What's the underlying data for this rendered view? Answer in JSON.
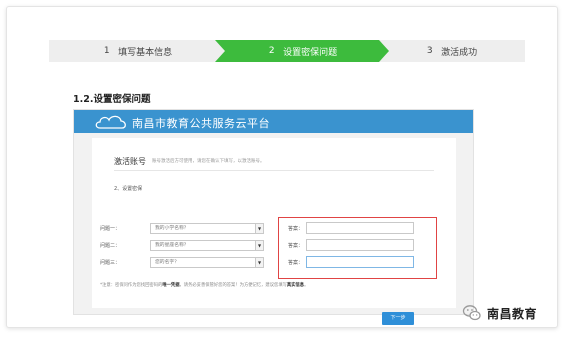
{
  "steps": [
    {
      "num": "1",
      "label": "填写基本信息",
      "state": "done"
    },
    {
      "num": "2",
      "label": "设置密保问题",
      "state": "active"
    },
    {
      "num": "3",
      "label": "激活成功",
      "state": "pending"
    }
  ],
  "section_title": "1.2.设置密保问题",
  "app": {
    "platform_name": "南昌市教育公共服务云平台",
    "panel_title": "激活账号",
    "panel_desc": "账号激活后方可使用，请您在确认下填写，以激活账号。",
    "subhead": "2、设置密保",
    "questions": [
      {
        "label": "问题一：",
        "selected": "我的小学名称？",
        "answer_label": "答案：",
        "answer": ""
      },
      {
        "label": "问题二：",
        "selected": "我的星座名称？",
        "answer_label": "答案：",
        "answer": ""
      },
      {
        "label": "问题三：",
        "selected": "您的名字？",
        "answer_label": "答案：",
        "answer": ""
      }
    ],
    "note_prefix": "*注意：密保问作为您找回密码的",
    "note_bold1": "唯一凭据",
    "note_mid": "，请务必妥善保管好您的答案！为方便记忆，建议您填写",
    "note_bold2": "真实信息",
    "note_end": "。",
    "next_button": "下一步"
  },
  "watermark": "南昌教育",
  "colors": {
    "active_step": "#3dbb3d",
    "banner": "#3a93cf",
    "highlight": "#e04444",
    "button": "#2f8fd8"
  }
}
